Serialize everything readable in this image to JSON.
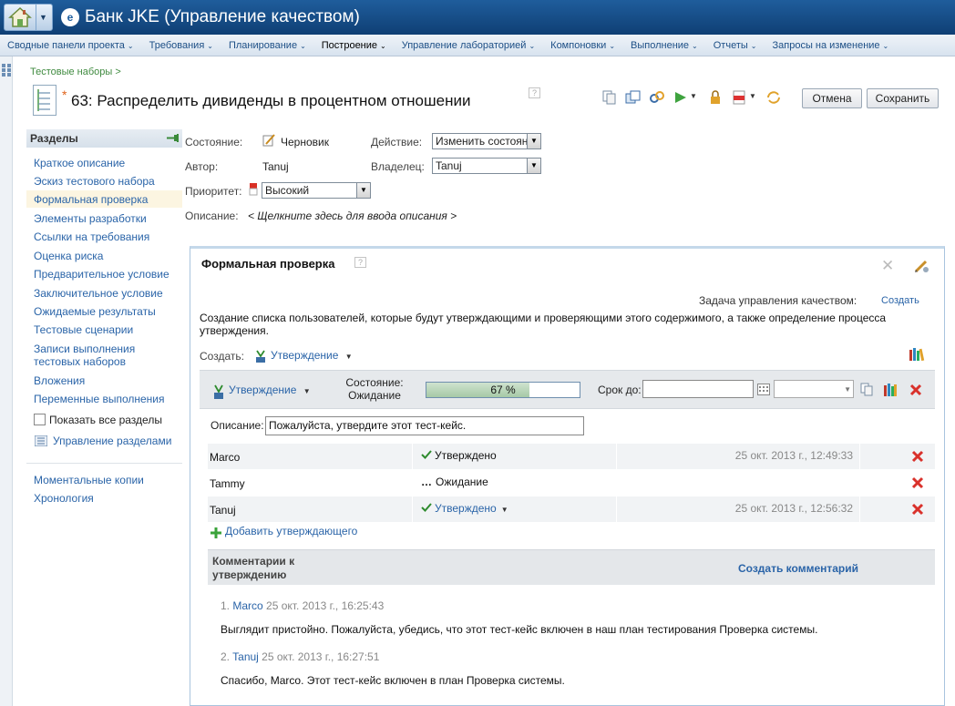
{
  "app": {
    "title": "Банк JKE (Управление качеством)",
    "logo_glyph": "e"
  },
  "nav": {
    "items": [
      {
        "label": "Сводные панели проекта",
        "active": false
      },
      {
        "label": "Требования",
        "active": false
      },
      {
        "label": "Планирование",
        "active": false
      },
      {
        "label": "Построение",
        "active": true
      },
      {
        "label": "Управление лабораторией",
        "active": false
      },
      {
        "label": "Компоновки",
        "active": false
      },
      {
        "label": "Выполнение",
        "active": false
      },
      {
        "label": "Отчеты",
        "active": false
      },
      {
        "label": "Запросы на изменение",
        "active": false
      }
    ],
    "chevron": "⌄"
  },
  "breadcrumb": "Тестовые наборы >",
  "page": {
    "star": "*",
    "title": "63:  Распределить дивиденды в процентном отношении",
    "help": "?"
  },
  "buttons": {
    "cancel": "Отмена",
    "save": "Сохранить"
  },
  "sidebar": {
    "heading": "Разделы",
    "items": [
      "Краткое описание",
      "Эскиз тестового набора",
      "Формальная проверка",
      "Элементы разработки",
      "Ссылки на требования",
      "Оценка риска",
      "Предварительное условие",
      "Заключительное условие",
      "Ожидаемые результаты",
      "Тестовые сценарии",
      "Записи выполнения тестовых наборов",
      "Вложения",
      "Переменные выполнения"
    ],
    "show_all": "Показать все разделы",
    "manage": "Управление разделами",
    "snapshots": "Моментальные копии",
    "history": "Хронология"
  },
  "form": {
    "state_label": "Состояние:",
    "state_value": "Черновик",
    "action_label": "Действие:",
    "action_value": "Изменить состояние",
    "author_label": "Автор:",
    "author_value": "Tanuj",
    "owner_label": "Владелец:",
    "owner_value": "Tanuj",
    "priority_label": "Приоритет:",
    "priority_value": "Высокий",
    "description_label": "Описание:",
    "description_placeholder": "< Щелкните здесь для ввода описания >"
  },
  "panel": {
    "title": "Формальная проверка",
    "help": "?",
    "close": "✕",
    "task_label": "Задача управления качеством:",
    "task_create": "Создать",
    "description": "Создание списка пользователей, которые будут утверждающими и проверяющими этого содержимого, а также определение процесса утверждения.",
    "create_label": "Создать:",
    "create_type": "Утверждение",
    "approval": {
      "type": "Утверждение",
      "state_label": "Состояние:",
      "state_value": "Ожидание",
      "progress": 67,
      "progress_text": "67 %",
      "due_label": "Срок до:",
      "description_label": "Описание:",
      "description_value": "Пожалуйста, утвердите этот тест-кейс."
    },
    "approvers": [
      {
        "name": "Marco",
        "status": "Утверждено",
        "status_icon": "check",
        "date": "25 окт. 2013 г., 12:49:33",
        "is_link": false
      },
      {
        "name": "Tammy",
        "status": "Ожидание",
        "status_icon": "dots",
        "date": "",
        "is_link": false
      },
      {
        "name": "Tanuj",
        "status": "Утверждено",
        "status_icon": "check",
        "date": "25 окт. 2013 г., 12:56:32",
        "is_link": true
      }
    ],
    "add_approver": "Добавить утверждающего",
    "comments_title": "Комментарии к утверждению",
    "comments_create": "Создать комментарий",
    "comments": [
      {
        "index": "1.",
        "author": "Marco",
        "date": "25 окт. 2013 г., 16:25:43",
        "text": "Выглядит пристойно. Пожалуйста, убедись, что этот тест-кейс включен в наш план тестирования Проверка системы."
      },
      {
        "index": "2.",
        "author": "Tanuj",
        "date": "25 окт. 2013 г., 16:27:51",
        "text": "Спасибо, Marco. Этот тест-кейс включен в план Проверка системы."
      }
    ]
  },
  "colors": {
    "title_bar": "#14497f",
    "link": "#2a64a8",
    "active_section": "#fcf5e1",
    "delete": "#d9312b",
    "approved": "#2e8b2e"
  }
}
